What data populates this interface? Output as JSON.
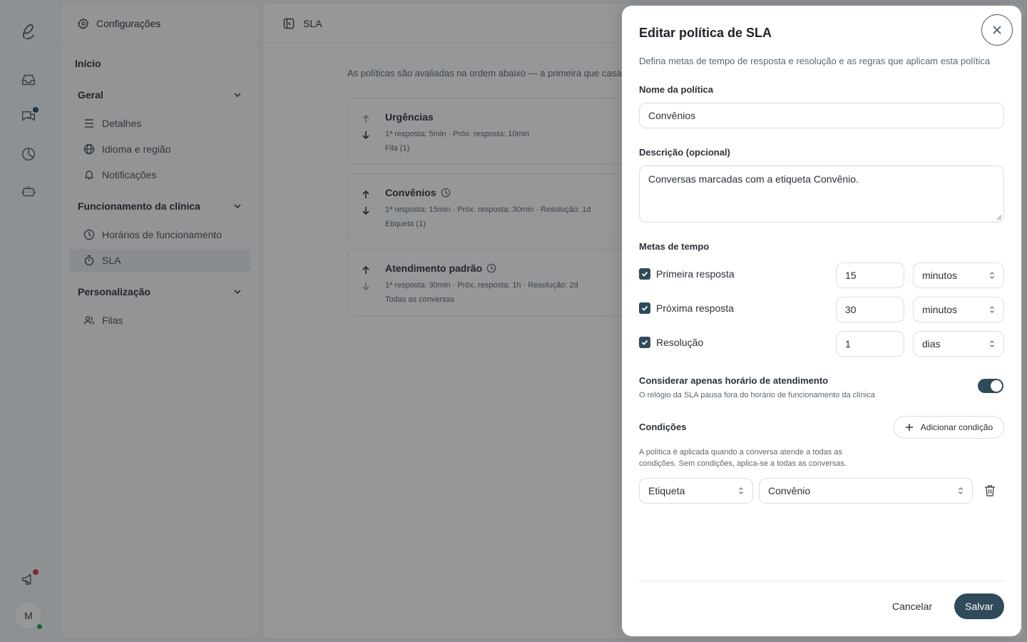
{
  "rail": {
    "icons": [
      "logo-icon",
      "inbox-icon",
      "chat-icon",
      "reports-icon",
      "bot-icon",
      "announcement-icon"
    ],
    "avatar_initial": "M"
  },
  "sidebar": {
    "title": "Configurações",
    "home": "Início",
    "sections": [
      {
        "label": "Geral",
        "items": [
          "Detalhes",
          "Idioma e região",
          "Notificações"
        ]
      },
      {
        "label": "Funcionamento da clínica",
        "items": [
          "Horários de funcionamento",
          "SLA"
        ]
      },
      {
        "label": "Personalização",
        "items": [
          "Filas"
        ]
      }
    ],
    "active_item": "SLA"
  },
  "main": {
    "title": "SLA",
    "description": "As políticas são avaliadas na ordem abaixo — a primeira que casa",
    "policies": [
      {
        "name": "Urgências",
        "metrics": "1ª resposta: 5min · Próx. resposta: 10min",
        "scope": "Fila (1)"
      },
      {
        "name": "Convênios",
        "metrics": "1ª resposta: 15min · Próx. resposta: 30min · Resolução: 1d",
        "scope": "Etiqueta (1)"
      },
      {
        "name": "Atendimento padrão",
        "metrics": "1ª resposta: 30min · Próx. resposta: 1h · Resolução: 2d",
        "scope": "Todas as conversas"
      }
    ]
  },
  "modal": {
    "title": "Editar política de SLA",
    "subtitle": "Defina metas de tempo de resposta e resolução e as regras que aplicam esta política",
    "name_label": "Nome da política",
    "name_value": "Convênios",
    "desc_label": "Descrição (opcional)",
    "desc_value": "Conversas marcadas com a etiqueta Convênio.",
    "targets_label": "Metas de tempo",
    "targets": [
      {
        "label": "Primeira resposta",
        "checked": true,
        "value": "15",
        "unit": "minutos"
      },
      {
        "label": "Próxima resposta",
        "checked": true,
        "value": "30",
        "unit": "minutos"
      },
      {
        "label": "Resolução",
        "checked": true,
        "value": "1",
        "unit": "dias"
      }
    ],
    "business_hours_label": "Considerar apenas horário de atendimento",
    "business_hours_hint": "O relógio da SLA pausa fora do horário de funcionamento da clínica",
    "business_hours_on": true,
    "conditions_label": "Condições",
    "add_condition": "Adicionar condição",
    "conditions_hint_1": "A política é aplicada quando a conversa atende a todas as",
    "conditions_hint_2": "condições. Sem condições, aplica-se a todas as conversas.",
    "condition": {
      "field": "Etiqueta",
      "value": "Convênio"
    },
    "cancel": "Cancelar",
    "save": "Salvar"
  },
  "colors": {
    "accent": "#2f4b59",
    "notify_dot": "#d33b3b",
    "online_dot": "#22a35a"
  }
}
